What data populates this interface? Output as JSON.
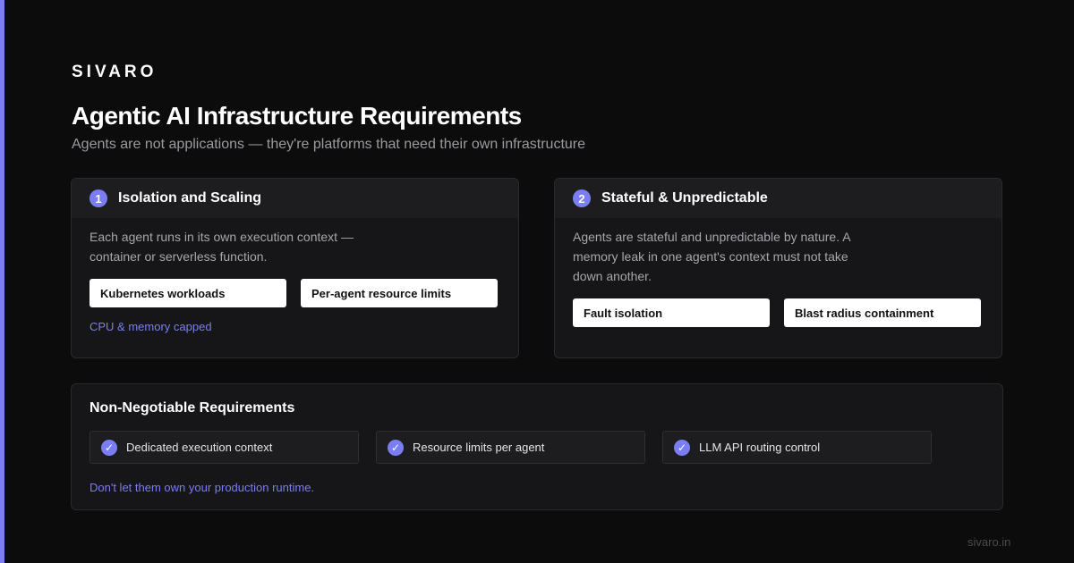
{
  "brand": "SIVARO",
  "title": "Agentic AI Infrastructure Requirements",
  "subtitle": "Agents are not applications — they're platforms that need their own infrastructure",
  "cards": [
    {
      "number": "1",
      "title": "Isolation and Scaling",
      "description": "Each agent runs in its own execution context — container or serverless function.",
      "tags": [
        "Kubernetes workloads",
        "Per-agent resource limits"
      ],
      "note": "CPU & memory capped"
    },
    {
      "number": "2",
      "title": "Stateful & Unpredictable",
      "description": "Agents are stateful and unpredictable by nature. A memory leak in one agent's context must not take down another.",
      "tags": [
        "Fault isolation",
        "Blast radius containment"
      ]
    }
  ],
  "requirements": {
    "title": "Non-Negotiable Requirements",
    "items": [
      "Dedicated execution context",
      "Resource limits per agent",
      "LLM API routing control"
    ],
    "check_icon": "check-icon",
    "footer": "Don't let them own your production runtime."
  },
  "site": "sivaro.in",
  "colors": {
    "accent": "#7b7ef2",
    "background": "#0c0c0c",
    "card": "#161618",
    "muted_text": "#9a9aa0"
  }
}
